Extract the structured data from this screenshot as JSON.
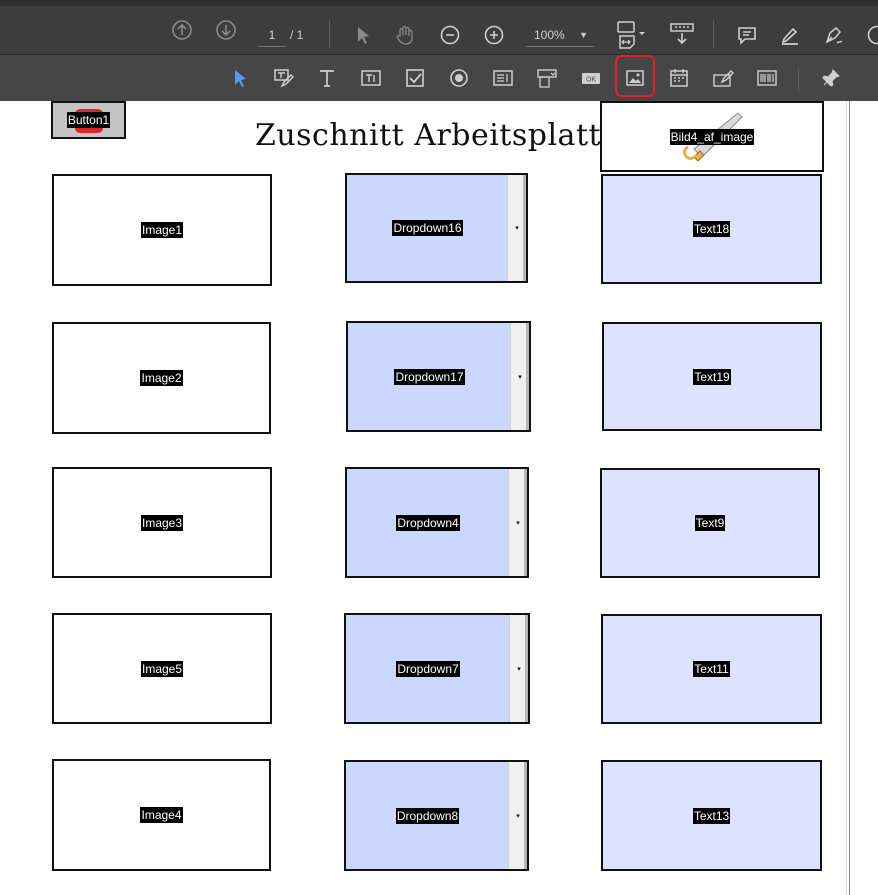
{
  "toolbar_top": {
    "page_current": "1",
    "page_total": "/ 1",
    "zoom_value": "100%",
    "icons": [
      "arrow-up-icon",
      "arrow-down-icon",
      "select-icon",
      "hand-icon",
      "zoom-out-icon",
      "zoom-in-icon",
      "fit-page-icon",
      "scroll-mode-icon",
      "comment-icon",
      "highlight-icon",
      "sign-icon",
      "more-icon"
    ]
  },
  "toolbar_forms": {
    "icons": [
      "select-object-icon",
      "edit-field-icon",
      "text-icon",
      "text-field-icon",
      "checkbox-icon",
      "radio-icon",
      "list-box-icon",
      "dropdown-icon",
      "button-icon",
      "image-icon",
      "date-icon",
      "signature-icon",
      "barcode-icon",
      "pin-icon"
    ],
    "active_accent": "#4a9eff",
    "highlight_color": "#e0222a"
  },
  "document": {
    "title": "Zuschnitt Arbeitsplatten",
    "button1": "Button1",
    "bild4": "Bild4_af_image",
    "images": [
      "Image1",
      "Image2",
      "Image3",
      "Image5",
      "Image4"
    ],
    "dropdowns": [
      "Dropdown16",
      "Dropdown17",
      "Dropdown4",
      "Dropdown7",
      "Dropdown8"
    ],
    "texts": [
      "Text18",
      "Text19",
      "Text9",
      "Text11",
      "Text13"
    ],
    "dropdown_arrow": "▾"
  }
}
